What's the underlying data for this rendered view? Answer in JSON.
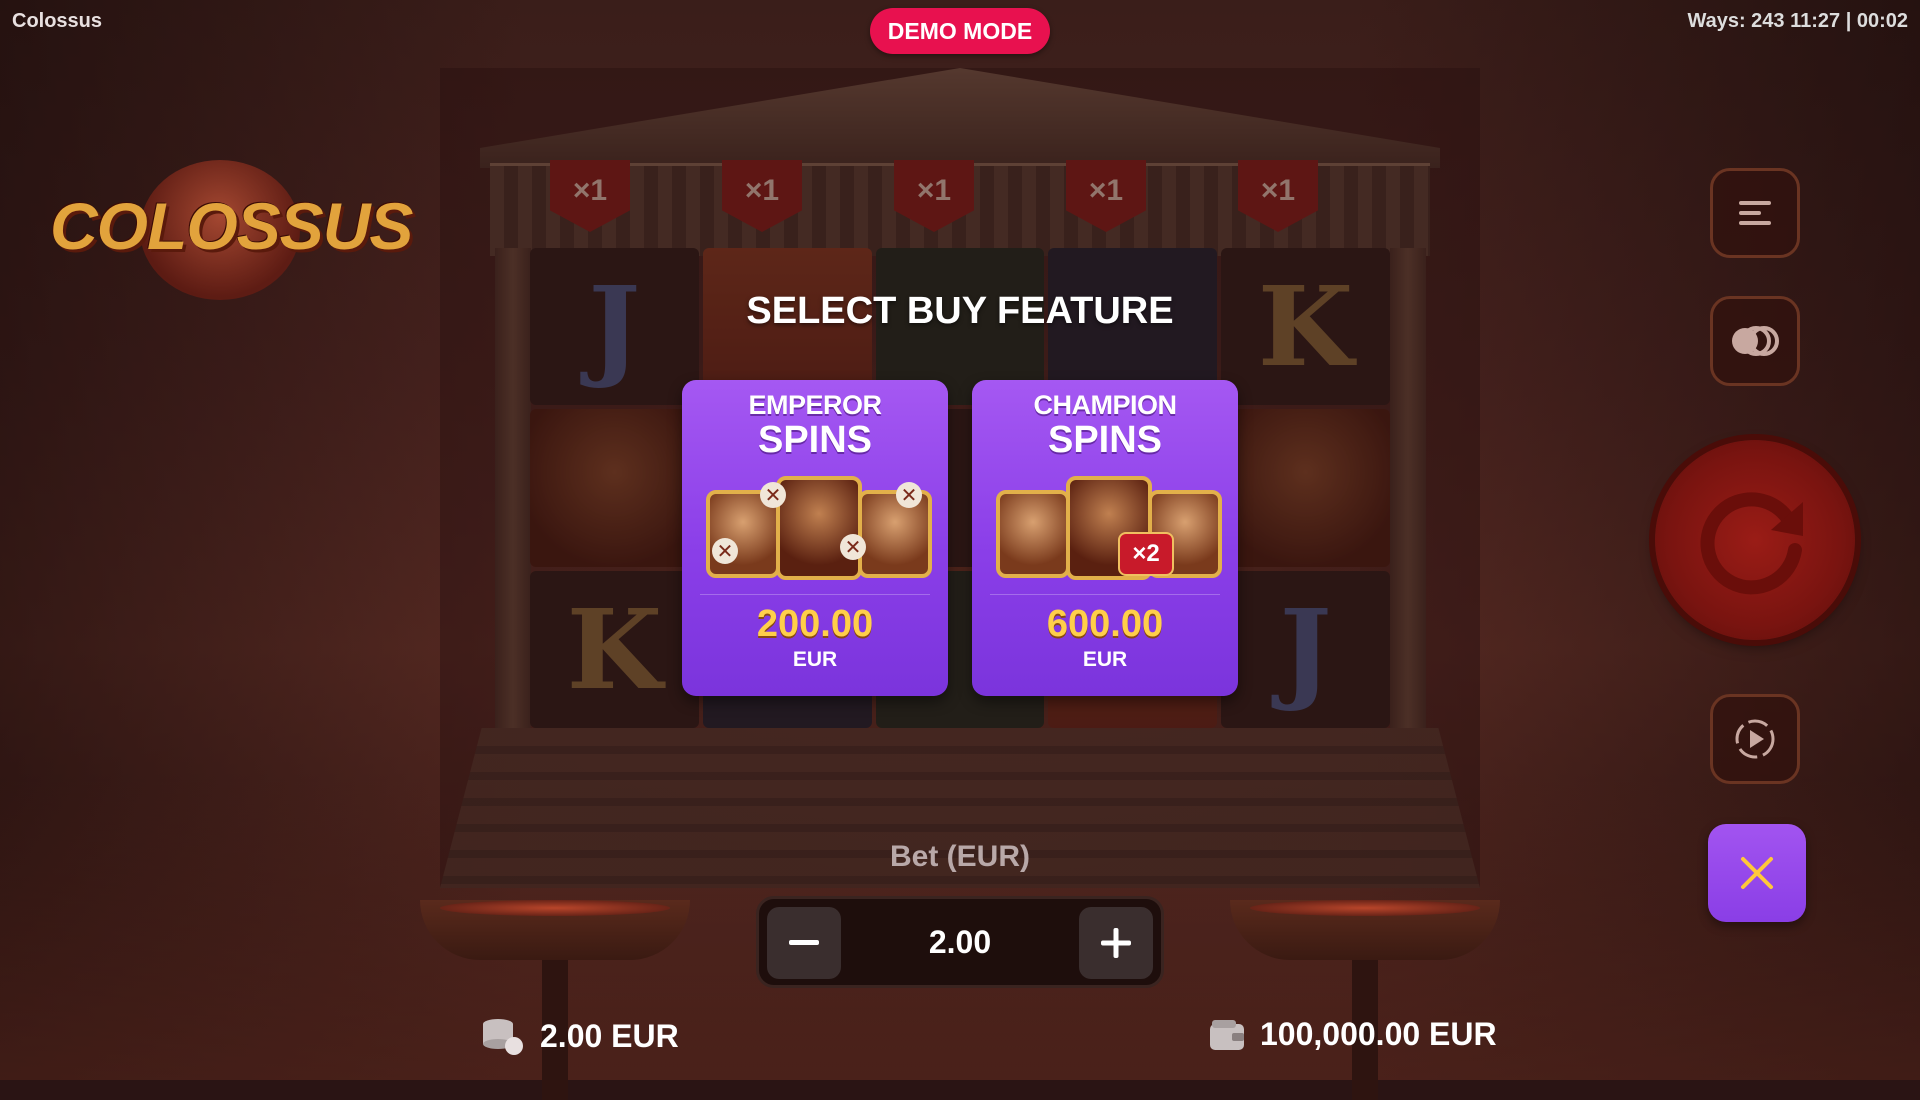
{
  "header": {
    "app_title": "Colossus",
    "demo_badge": "DEMO MODE",
    "status": "Ways: 243  11:27 | 00:02"
  },
  "logo": {
    "text": "COLOSSUS"
  },
  "reels": {
    "multipliers": [
      "×1",
      "×1",
      "×1",
      "×1",
      "×1"
    ],
    "cells": [
      {
        "symbol": "J",
        "style": "dark"
      },
      {
        "symbol": "",
        "style": "red"
      },
      {
        "symbol": "",
        "style": "green"
      },
      {
        "symbol": "",
        "style": "blue"
      },
      {
        "symbol": "K",
        "style": "dark"
      },
      {
        "symbol": "",
        "style": "warrior"
      },
      {
        "symbol": "",
        "style": "dark"
      },
      {
        "symbol": "",
        "style": "dark"
      },
      {
        "symbol": "",
        "style": "dark"
      },
      {
        "symbol": "",
        "style": "warrior"
      },
      {
        "symbol": "K",
        "style": "dark"
      },
      {
        "symbol": "",
        "style": "blue"
      },
      {
        "symbol": "",
        "style": "green"
      },
      {
        "symbol": "",
        "style": "red"
      },
      {
        "symbol": "J",
        "style": "dark"
      }
    ]
  },
  "buy_feature": {
    "title": "SELECT BUY FEATURE",
    "options": [
      {
        "name_line1": "EMPEROR",
        "name_line2": "SPINS",
        "price": "200.00",
        "currency": "EUR"
      },
      {
        "name_line1": "CHAMPION",
        "name_line2": "SPINS",
        "price": "600.00",
        "currency": "EUR",
        "badge": "×2"
      }
    ]
  },
  "bet": {
    "label": "Bet (EUR)",
    "value": "2.00"
  },
  "footer": {
    "bet_display": "2.00 EUR",
    "balance": "100,000.00 EUR"
  },
  "controls": {
    "icons": [
      "menu-icon",
      "toggle-icon",
      "spin-icon",
      "autoplay-icon",
      "close-icon"
    ]
  },
  "colors": {
    "demo_badge": "#e8114f",
    "card_purple": "#8a3ee8",
    "price_gold": "#ffcf4a",
    "spin_red": "#9a1c16"
  }
}
